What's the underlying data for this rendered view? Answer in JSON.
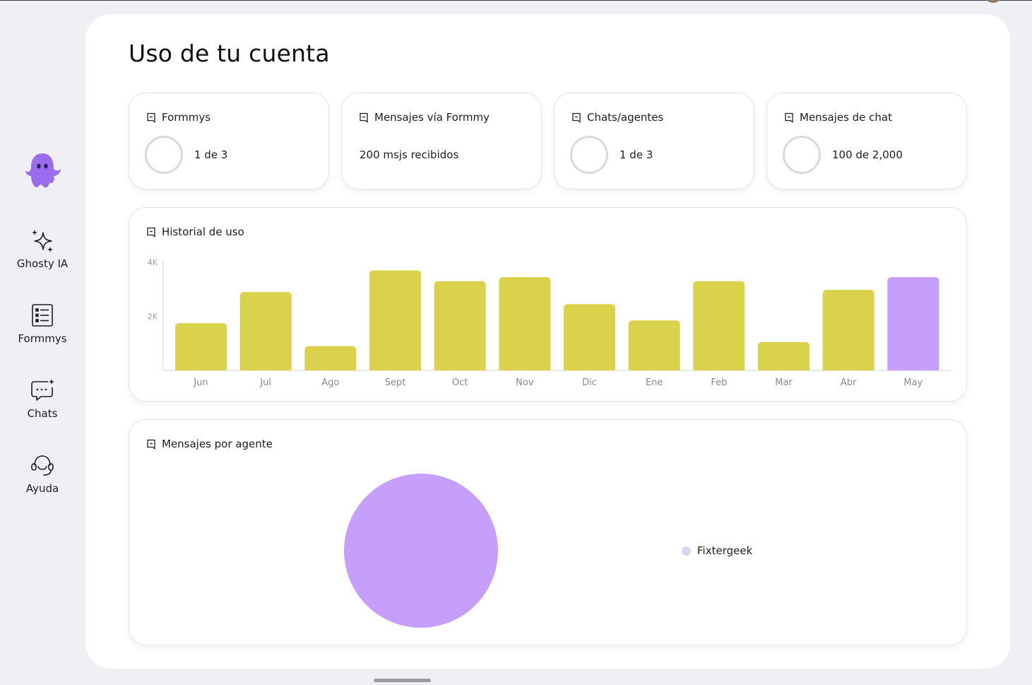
{
  "page": {
    "title": "Uso de tu cuenta"
  },
  "sidebar": {
    "logo_icon": "ghost-logo-icon",
    "items": [
      {
        "label": "Ghosty IA",
        "icon": "sparkles-icon"
      },
      {
        "label": "Formmys",
        "icon": "form-list-icon"
      },
      {
        "label": "Chats",
        "icon": "chat-bubble-icon"
      },
      {
        "label": "Ayuda",
        "icon": "headset-icon"
      }
    ]
  },
  "stats": [
    {
      "title": "Formmys",
      "value": "1 de 3",
      "ring": true
    },
    {
      "title": "Mensajes vía Formmy",
      "value": "200 msjs recibidos",
      "ring": false
    },
    {
      "title": "Chats/agentes",
      "value": "1 de 3",
      "ring": true
    },
    {
      "title": "Mensajes de chat",
      "value": "100 de 2,000",
      "ring": true
    }
  ],
  "usage_history": {
    "title": "Historial de uso"
  },
  "agent_messages": {
    "title": "Mensajes por agente",
    "legend": [
      "Fixtergeek"
    ]
  },
  "colors": {
    "bar": "#dbd24c",
    "bar_highlight": "#c59ffb",
    "pie": "#c59ffb",
    "accent": "#9c6cf0"
  },
  "chart_data": [
    {
      "type": "bar",
      "title": "Historial de uso",
      "categories": [
        "Jun",
        "Jul",
        "Ago",
        "Sept",
        "Oct",
        "Nov",
        "Dic",
        "Ene",
        "Feb",
        "Mar",
        "Abr",
        "May"
      ],
      "values": [
        1750,
        2900,
        900,
        3700,
        3300,
        3450,
        2450,
        1850,
        3300,
        1050,
        2980,
        3450
      ],
      "highlight_index": 11,
      "ylim": [
        0,
        4000
      ],
      "yticks": [
        {
          "v": 2000,
          "label": "2K"
        },
        {
          "v": 4000,
          "label": "4K"
        }
      ],
      "grid": false
    },
    {
      "type": "pie",
      "title": "Mensajes por agente",
      "slices": [
        {
          "label": "Fixtergeek",
          "value": 100
        }
      ],
      "legend_position": "right"
    }
  ]
}
